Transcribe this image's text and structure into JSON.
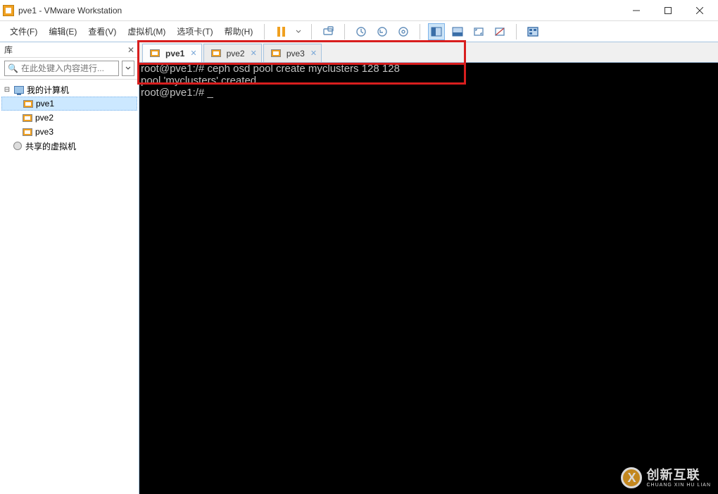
{
  "title": "pve1 - VMware Workstation",
  "menus": [
    "文件(F)",
    "编辑(E)",
    "查看(V)",
    "虚拟机(M)",
    "选项卡(T)",
    "帮助(H)"
  ],
  "library": {
    "title": "库",
    "search_placeholder": "在此处键入内容进行...",
    "tree": {
      "root": "我的计算机",
      "children": [
        "pve1",
        "pve2",
        "pve3"
      ],
      "shared": "共享的虚拟机"
    }
  },
  "tabs": [
    {
      "label": "pve1",
      "active": true
    },
    {
      "label": "pve2",
      "active": false
    },
    {
      "label": "pve3",
      "active": false
    }
  ],
  "terminal": {
    "line1": "root@pve1:/# ceph osd pool create myclusters 128 128",
    "line2": "pool 'myclusters' created",
    "line3": "root@pve1:/# _"
  },
  "watermark": {
    "cn": "创新互联",
    "en": "CHUANG XIN HU LIAN"
  }
}
